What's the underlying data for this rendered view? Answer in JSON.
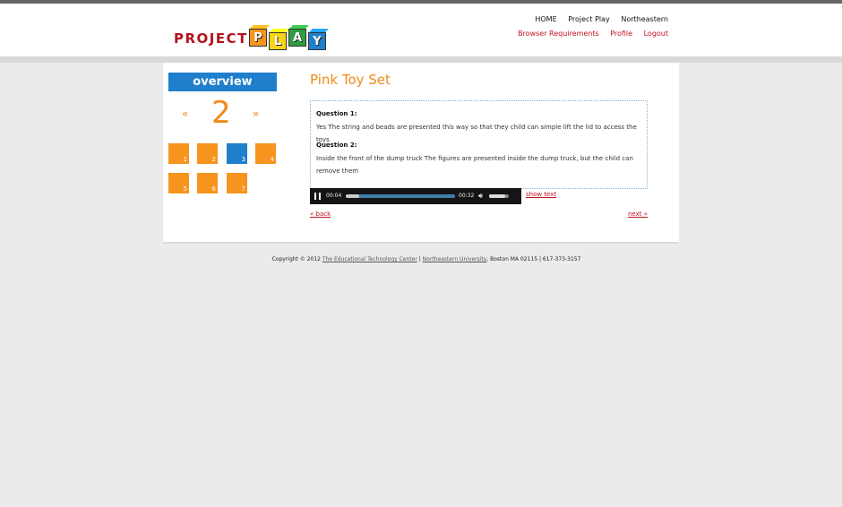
{
  "header": {
    "logo_word": "PROJECT",
    "logo_blocks": [
      {
        "letter": "P",
        "color": "#f7941d"
      },
      {
        "letter": "L",
        "color": "#f7d417"
      },
      {
        "letter": "A",
        "color": "#2e9e3e"
      },
      {
        "letter": "Y",
        "color": "#1f7fcc"
      }
    ],
    "nav_top": [
      "HOME",
      "Project Play",
      "Northeastern"
    ],
    "nav_sub": [
      "Browser Requirements",
      "Profile",
      "Logout"
    ]
  },
  "sidebar": {
    "overview_label": "overview",
    "prev_symbol": "«",
    "current_page": "2",
    "next_symbol": "»",
    "tiles": [
      "1",
      "2",
      "3",
      "4",
      "5",
      "6",
      "7"
    ],
    "active_tile": "3"
  },
  "main": {
    "title": "Pink Toy Set",
    "questions": [
      {
        "label": "Question 1:",
        "text": "Yes The string and beads are presented this way so that they child can simple lift the lid to access the toys"
      },
      {
        "label": "Question 2:",
        "text": "Inside the front of the dump truck The figures are presented inside the dump truck, but the child can remove them"
      }
    ],
    "player": {
      "current_time": "00:04",
      "total_time": "00:32",
      "progress": 0.125,
      "volume": 0.8
    },
    "show_text": "show text",
    "back": "« back",
    "next": "next »"
  },
  "footer": {
    "prefix": "Copyright © 2012 ",
    "link1": "The Educational Technology Center",
    "sep1": " | ",
    "link2": "Northeastern University",
    "suffix": ", Boston MA 02115 | 617-373-3157"
  },
  "colors": {
    "accent_orange": "#f7941d",
    "accent_blue": "#1f7fcc",
    "link_red": "#c0111f"
  }
}
